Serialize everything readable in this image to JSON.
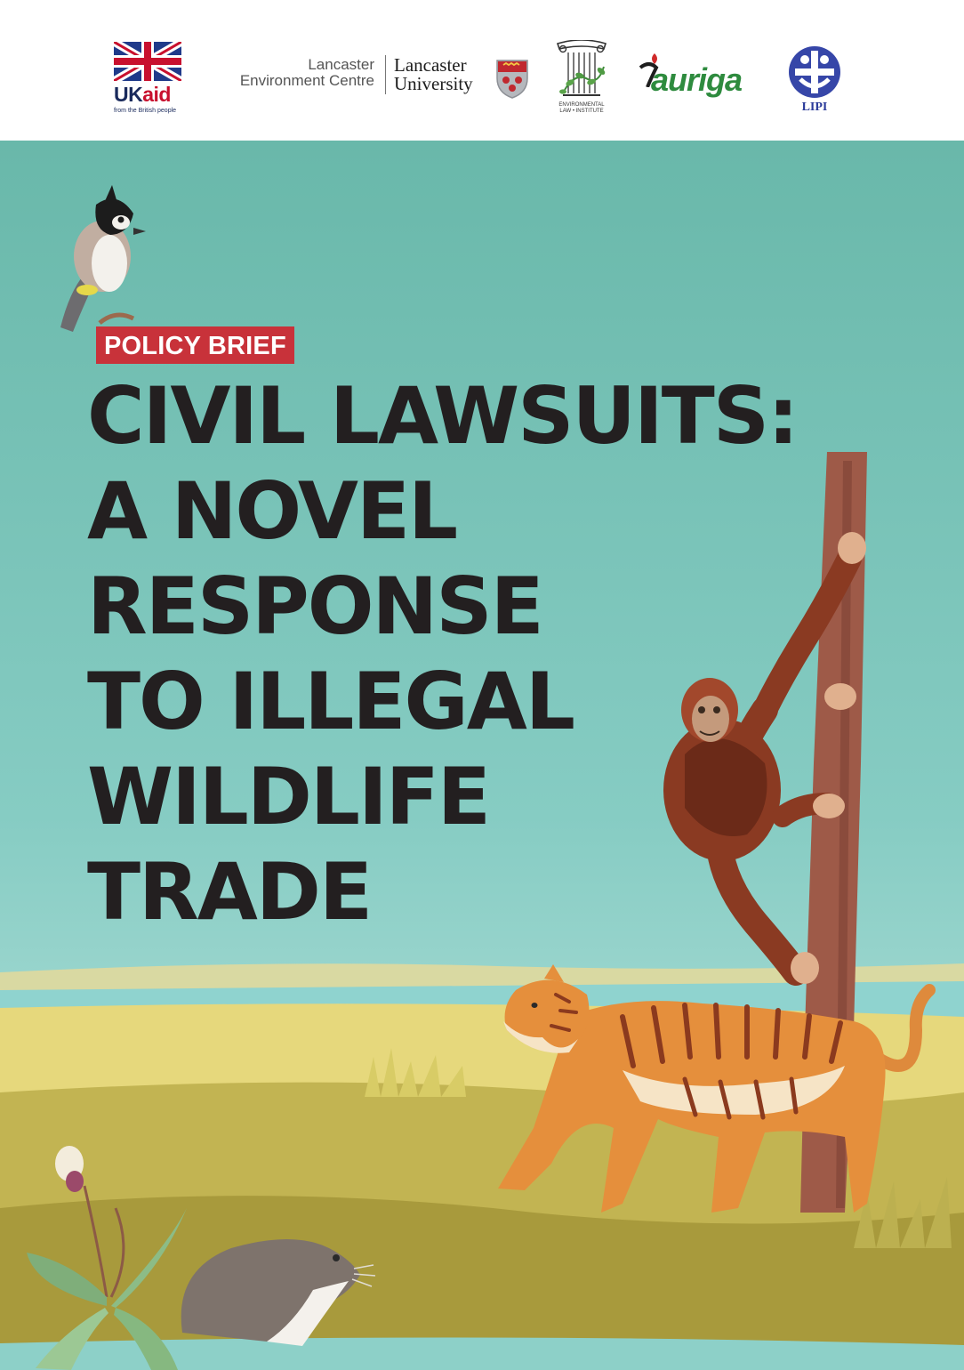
{
  "logos": {
    "ukaid": {
      "word_uk": "UK",
      "word_aid": "aid",
      "tagline": "from the British people"
    },
    "lancaster_env": {
      "line1": "Lancaster",
      "line2": "Environment Centre"
    },
    "lancaster_univ": {
      "line1": "Lancaster",
      "line2": "University"
    },
    "eli": {
      "line1": "ENVIRONMENTAL",
      "line2": "LAW • INSTITUTE"
    },
    "auriga": {
      "word": "auriga"
    },
    "lipi": {
      "word": "LIPI"
    }
  },
  "cover": {
    "badge": "POLICY BRIEF",
    "title_lines": [
      "CIVIL LAWSUITS:",
      "A NOVEL",
      "RESPONSE",
      "TO ILLEGAL",
      "WILDLIFE",
      "TRADE"
    ]
  },
  "colors": {
    "sky_top": "#69b8aa",
    "sky_bottom": "#c0e6e2",
    "badge": "#c8323a",
    "title": "#231f20",
    "ground": "#c2b452",
    "water": "#8fd3cf"
  }
}
